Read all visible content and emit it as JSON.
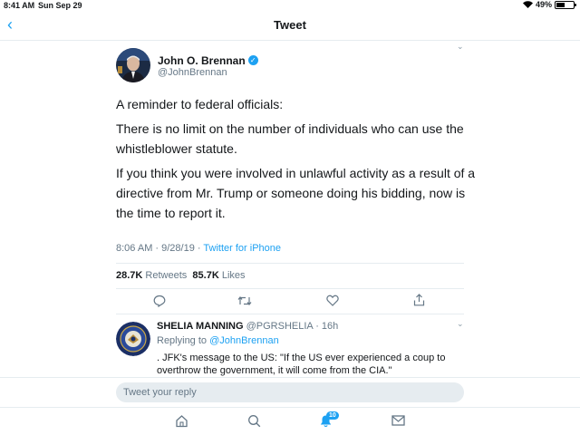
{
  "status_bar": {
    "time": "8:41 AM",
    "date": "Sun Sep 29",
    "battery": "49%",
    "battery_level": 0.49
  },
  "nav": {
    "title": "Tweet"
  },
  "tweet": {
    "name": "John O. Brennan",
    "handle": "@JohnBrennan",
    "paragraphs": [
      "A reminder to federal officials:",
      "There is no limit on the number of individuals who can use the whistleblower statute.",
      "If you think you were involved in unlawful activity as a result of a directive from Mr. Trump or someone doing his bidding, now is the time to report it."
    ],
    "timestamp": "8:06 AM · 9/28/19 · ",
    "source": "Twitter for iPhone",
    "retweets_count": "28.7K",
    "retweets_label": "Retweets",
    "likes_count": "85.7K",
    "likes_label": "Likes"
  },
  "reply": {
    "name": "SHELIA MANNING",
    "handle": "@PGRSHELIA",
    "time": " · 16h",
    "replying_to_label": "Replying to ",
    "replying_to_handle": "@JohnBrennan",
    "text": ". JFK's message to the US: \"If the US ever experienced a coup to overthrow the government, it will come from the CIA.\""
  },
  "compose": {
    "placeholder": "Tweet your reply"
  },
  "tab_bar": {
    "notifications_badge": "10"
  },
  "colors": {
    "accent": "#1da1f2",
    "secondary_text": "#657786",
    "divider": "#e6ecf0"
  }
}
